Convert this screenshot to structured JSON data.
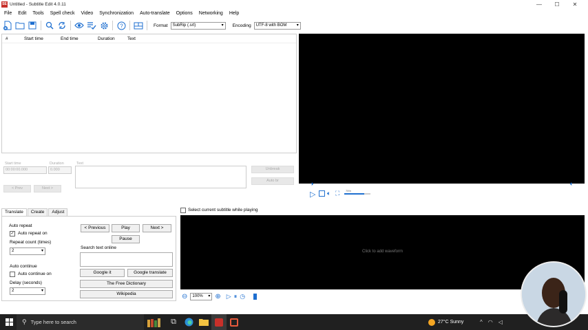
{
  "window": {
    "title": "Untitled - Subtitle Edit 4.0.11",
    "app_icon": "SE",
    "controls": [
      "—",
      "☐",
      "✕"
    ]
  },
  "menu": [
    "File",
    "Edit",
    "Tools",
    "Spell check",
    "Video",
    "Synchronization",
    "Auto-translate",
    "Options",
    "Networking",
    "Help"
  ],
  "toolbar": {
    "icons": [
      "new-file-icon",
      "open-folder-icon",
      "save-icon",
      "find-icon",
      "replace-icon",
      "visual-sync-icon",
      "spell-check-icon",
      "settings-icon",
      "help-icon",
      "layout-icon"
    ],
    "format_label": "Format",
    "format_value": "SubRip (.srt)",
    "encoding_label": "Encoding",
    "encoding_value": "UTF-8 with BOM"
  },
  "grid": {
    "columns": [
      "#",
      "Start time",
      "End time",
      "Duration",
      "Text"
    ]
  },
  "edit": {
    "start_time_label": "Start time",
    "start_time_value": "00:00:00.000",
    "duration_label": "Duration",
    "duration_value": "0.000",
    "text_label": "Text",
    "prev_label": "< Prev",
    "next_label": "Next >",
    "unbreak_label": "Unbreak",
    "auto_br_label": "Auto br"
  },
  "video": {
    "volume": "75%"
  },
  "lower": {
    "tabs": [
      "Translate",
      "Create",
      "Adjust"
    ],
    "active_tab": "Translate",
    "auto_repeat_title": "Auto repeat",
    "auto_repeat_on_label": "Auto repeat on",
    "auto_repeat_on_checked": true,
    "repeat_count_label": "Repeat count (times)",
    "repeat_count_value": "2",
    "auto_continue_title": "Auto continue",
    "auto_continue_on_label": "Auto continue on",
    "auto_continue_on_checked": false,
    "delay_label": "Delay (seconds)",
    "delay_value": "2",
    "prev_button": "< Previous",
    "play_button": "Play",
    "next_button": "Next >",
    "pause_button": "Pause",
    "search_online_label": "Search text online",
    "google_it": "Google it",
    "google_translate": "Google translate",
    "free_dictionary": "The Free Dictionary",
    "wikipedia": "Wikipedia"
  },
  "waveform": {
    "select_current_label": "Select current subtitle while playing",
    "click_to_add": "Click to add waveform",
    "zoom_value": "100%"
  },
  "taskbar": {
    "search_placeholder": "Type here to search",
    "weather": "27°C  Sunny"
  },
  "colors": {
    "accent": "#1e6fd0",
    "app_red": "#c8302a",
    "taskbar": "#202020"
  }
}
